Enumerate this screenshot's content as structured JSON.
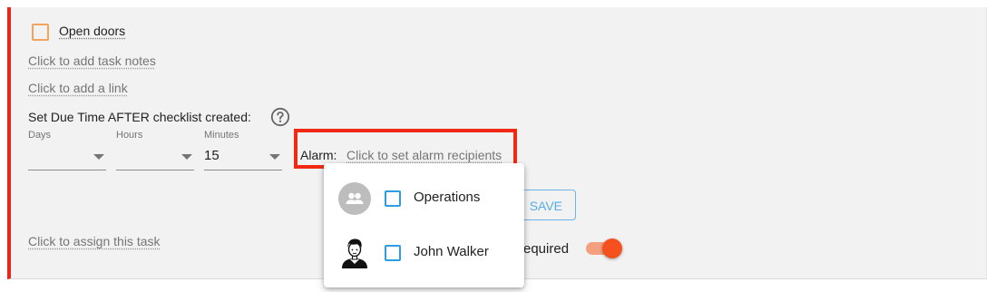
{
  "task": {
    "title": "Open doors",
    "notes_link": "Click to add task notes",
    "link_link": "Click to add a link",
    "due_time_label": "Set Due Time AFTER checklist created:",
    "days": {
      "label": "Days",
      "value": ""
    },
    "hours": {
      "label": "Hours",
      "value": ""
    },
    "minutes": {
      "label": "Minutes",
      "value": "15"
    },
    "alarm_label": "Alarm:",
    "alarm_link": "Click to set alarm recipients",
    "assign_link": "Click to assign this task",
    "save_label": "SAVE",
    "required_label": "equired",
    "required_enabled": true
  },
  "alarm_recipients": [
    {
      "name": "Operations",
      "type": "group",
      "checked": false,
      "icon": "group-icon"
    },
    {
      "name": "John Walker",
      "type": "user",
      "checked": false,
      "icon": "user-avatar"
    }
  ],
  "colors": {
    "accent_red": "#e8261f",
    "highlight": "#f22a14",
    "toggle": "#f4511e",
    "checkbox_orange": "#f2a35e",
    "checkbox_blue": "#2c9de0",
    "save_blue": "#57aee6"
  }
}
